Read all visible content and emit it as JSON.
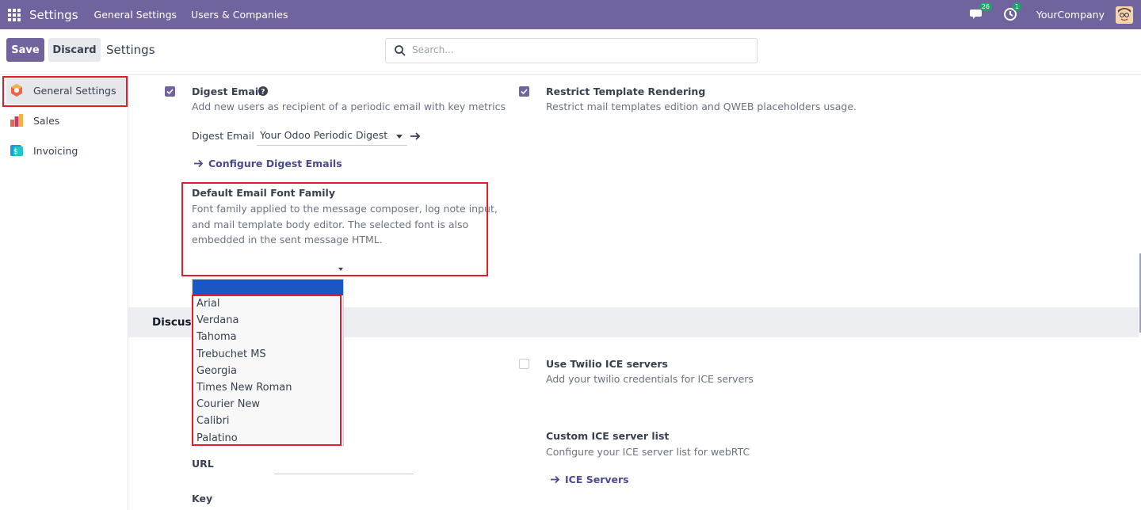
{
  "navbar": {
    "brand": "Settings",
    "menu": [
      "General Settings",
      "Users & Companies"
    ],
    "messages_count": "26",
    "activities_count": "1",
    "company": "YourCompany"
  },
  "control": {
    "save_label": "Save",
    "discard_label": "Discard",
    "title": "Settings",
    "search_placeholder": "Search..."
  },
  "sidebar": {
    "items": [
      {
        "label": "General Settings",
        "icon": "general-settings-icon"
      },
      {
        "label": "Sales",
        "icon": "sales-icon"
      },
      {
        "label": "Invoicing",
        "icon": "invoicing-icon"
      }
    ]
  },
  "settings": {
    "digest": {
      "title": "Digest Email",
      "desc": "Add new users as recipient of a periodic email with key metrics",
      "field_label": "Digest Email",
      "field_value": "Your Odoo Periodic Digest",
      "link": "Configure Digest Emails",
      "checked": true
    },
    "restrict": {
      "title": "Restrict Template Rendering",
      "desc": "Restrict mail templates edition and QWEB placeholders usage.",
      "checked": true
    },
    "font_family": {
      "title": "Default Email Font Family",
      "desc_line1": "Font family applied to the message composer, log note input,",
      "desc_line2": "and mail template body editor. The selected font is also",
      "desc_line3": "embedded in the sent message HTML.",
      "options": [
        "Arial",
        "Verdana",
        "Tahoma",
        "Trebuchet MS",
        "Georgia",
        "Times New Roman",
        "Courier New",
        "Calibri",
        "Palatino"
      ]
    },
    "discuss_section": "Discuss",
    "twilio": {
      "title": "Use Twilio ICE servers",
      "desc": "Add your twilio credentials for ICE servers",
      "checked": false
    },
    "ice": {
      "title": "Custom ICE server list",
      "desc": "Configure your ICE server list for webRTC",
      "link": "ICE Servers"
    },
    "url_label": "URL",
    "key_label": "Key"
  },
  "colors": {
    "navbar": "#71639e",
    "accent": "#71639e",
    "highlight": "#e11d2a"
  }
}
